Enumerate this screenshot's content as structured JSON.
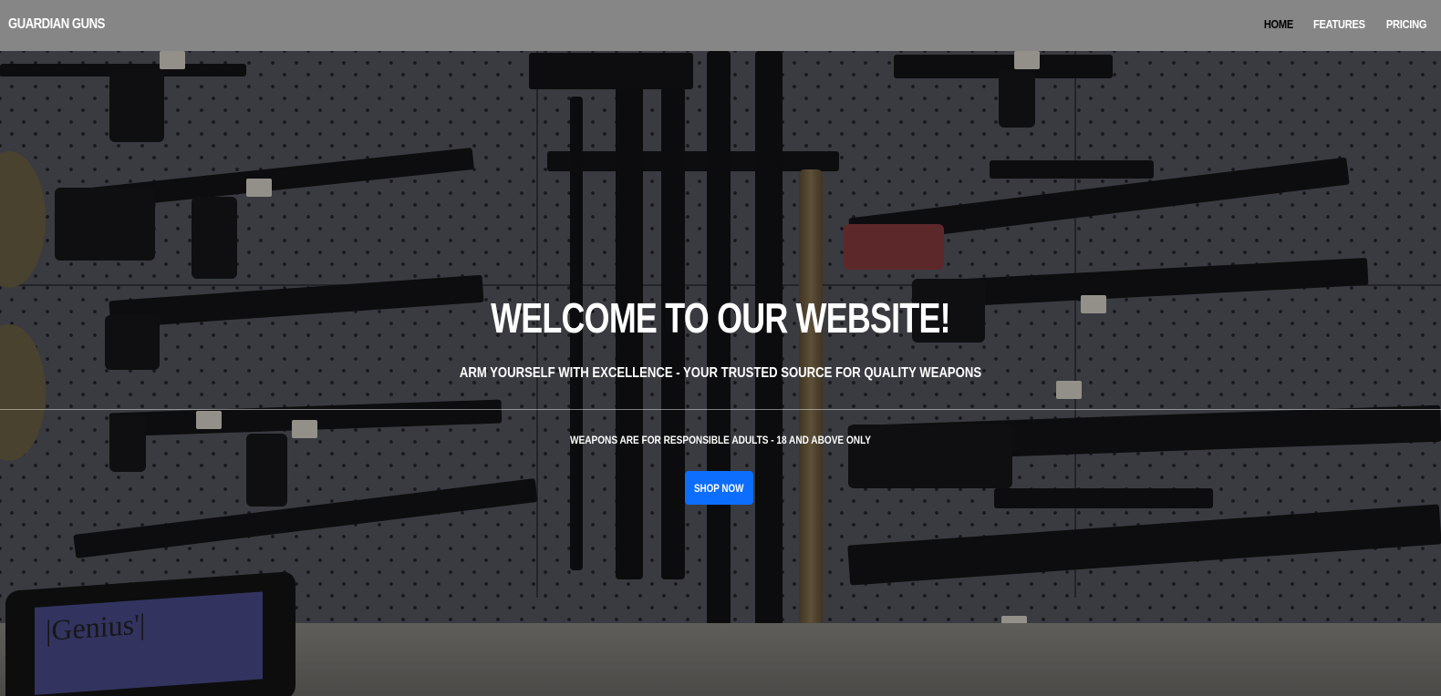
{
  "navbar": {
    "brand": "GUARDIAN GUNS",
    "links": [
      {
        "label": "HOME",
        "active": true
      },
      {
        "label": "FEATURES",
        "active": false
      },
      {
        "label": "PRICING",
        "active": false
      }
    ]
  },
  "hero": {
    "title": "WELCOME TO OUR WEBSITE!",
    "subtitle": "ARM YOURSELF WITH EXCELLENCE - YOUR TRUSTED SOURCE FOR QUALITY WEAPONS",
    "disclaimer": "WEAPONS ARE FOR RESPONSIBLE ADULTS - 18 AND ABOVE ONLY",
    "cta_label": "SHOP NOW",
    "background_image": "gun-store-pegboard-wall-photo",
    "terminal_brand": "|Genius'|"
  },
  "colors": {
    "navbar_bg": "#868686",
    "active_link": "#000000",
    "link": "#ffffff",
    "cta_bg": "#0d6efd",
    "hero_text": "#ffffff"
  }
}
